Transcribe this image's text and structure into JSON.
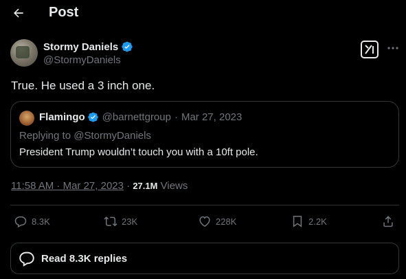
{
  "header": {
    "title": "Post"
  },
  "author": {
    "name": "Stormy Daniels",
    "handle": "@StormyDaniels",
    "verified_color": "#1d9bf0"
  },
  "tweet": {
    "text": "True. He used a 3 inch one."
  },
  "quote": {
    "name": "Flamingo",
    "handle": "@barnettgroup",
    "separator": "·",
    "date": "Mar 27, 2023",
    "replying_to": "Replying to @StormyDaniels",
    "text": "President Trump wouldn’t touch you with a 10ft pole."
  },
  "meta": {
    "timestamp": "11:58 AM · Mar 27, 2023",
    "separator": "·",
    "views_count": "27.1M",
    "views_label": "Views"
  },
  "actions": {
    "replies": "8.3K",
    "reposts": "23K",
    "likes": "228K",
    "bookmarks": "2.2K"
  },
  "read_replies": {
    "label": "Read 8.3K replies"
  },
  "icons": {
    "back": "arrow-left-icon",
    "verified": "verified-badge-icon",
    "grok": "grok-icon",
    "more": "more-icon",
    "reply": "reply-icon",
    "repost": "repost-icon",
    "like": "heart-icon",
    "bookmark": "bookmark-icon",
    "share": "share-icon"
  }
}
